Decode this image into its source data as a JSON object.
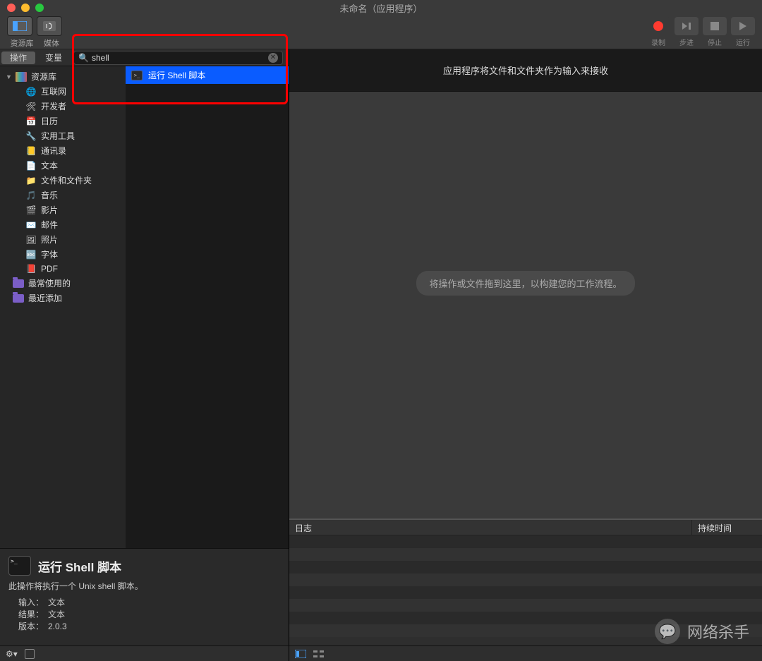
{
  "window": {
    "title": "未命名（应用程序）"
  },
  "toolbar": {
    "left": [
      {
        "name": "library-toggle",
        "label": "资源库"
      },
      {
        "name": "media-toggle",
        "label": "媒体"
      }
    ],
    "right": [
      {
        "name": "record-button",
        "label": "录制"
      },
      {
        "name": "step-button",
        "label": "步进"
      },
      {
        "name": "stop-button",
        "label": "停止"
      },
      {
        "name": "run-button",
        "label": "运行"
      }
    ]
  },
  "tabs": {
    "actions": "操作",
    "variables": "变量"
  },
  "search": {
    "value": "shell",
    "placeholder": ""
  },
  "library": {
    "root": "资源库",
    "categories": [
      {
        "label": "互联网",
        "icon": "globe-icon"
      },
      {
        "label": "开发者",
        "icon": "hammer-icon"
      },
      {
        "label": "日历",
        "icon": "calendar-icon"
      },
      {
        "label": "实用工具",
        "icon": "tools-icon"
      },
      {
        "label": "通讯录",
        "icon": "contacts-icon"
      },
      {
        "label": "文本",
        "icon": "text-icon"
      },
      {
        "label": "文件和文件夹",
        "icon": "files-icon"
      },
      {
        "label": "音乐",
        "icon": "music-icon"
      },
      {
        "label": "影片",
        "icon": "movie-icon"
      },
      {
        "label": "邮件",
        "icon": "mail-icon"
      },
      {
        "label": "照片",
        "icon": "photos-icon"
      },
      {
        "label": "字体",
        "icon": "font-icon"
      },
      {
        "label": "PDF",
        "icon": "pdf-icon"
      }
    ],
    "sections": [
      {
        "label": "最常使用的",
        "icon": "folder-icon"
      },
      {
        "label": "最近添加",
        "icon": "folder-icon"
      }
    ]
  },
  "results": [
    {
      "label": "运行 Shell 脚本",
      "selected": true
    }
  ],
  "detail": {
    "title": "运行 Shell 脚本",
    "desc": "此操作将执行一个 Unix shell 脚本。",
    "input_label": "输入：",
    "input_value": "文本",
    "result_label": "结果：",
    "result_value": "文本",
    "version_label": "版本：",
    "version_value": "2.0.3"
  },
  "workflow": {
    "header": "应用程序将文件和文件夹作为输入来接收",
    "drop_hint": "将操作或文件拖到这里，以构建您的工作流程。"
  },
  "log": {
    "col_log": "日志",
    "col_duration": "持续时间"
  },
  "watermark": {
    "text": "网络杀手"
  }
}
